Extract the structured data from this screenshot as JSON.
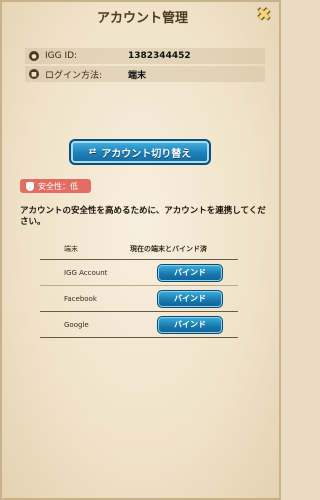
{
  "header": {
    "title": "アカウント管理",
    "close_symbol": "✖"
  },
  "account": {
    "igg_label": "IGG ID:",
    "igg_value": "1382344452",
    "login_label": "ログイン方法:",
    "login_value": "端末"
  },
  "switch_button": {
    "label": "アカウント切り替え",
    "icon": "⇄"
  },
  "security": {
    "badge": "安全性：低",
    "notice": "アカウントの安全性を高めるために、アカウントを連携してください。"
  },
  "binding_table": {
    "headers": [
      "端末",
      "現在の端末とバインド済"
    ],
    "rows": [
      {
        "name": "IGG Account",
        "action": "バインド"
      },
      {
        "name": "Facebook",
        "action": "バインド"
      },
      {
        "name": "Google",
        "action": "バインド"
      }
    ]
  }
}
